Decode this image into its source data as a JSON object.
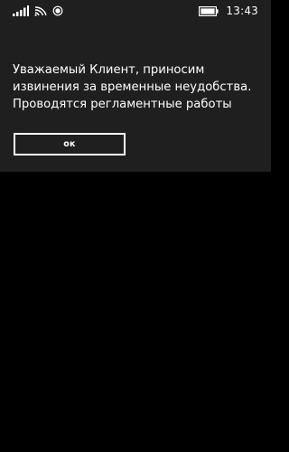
{
  "status_bar": {
    "icons": [
      "signal-strength-icon",
      "wifi-icon",
      "location-icon"
    ],
    "battery_icon": "battery-icon",
    "time": "13:43"
  },
  "dialog": {
    "message": "Уважаемый Клиент, приносим\nизвинения за временные неудобства.\nПроводятся регламентные работы",
    "ok_label": "ок"
  },
  "colors": {
    "dialog_background": "#1f1f1f",
    "screen_background": "#000000",
    "text": "#ffffff"
  }
}
